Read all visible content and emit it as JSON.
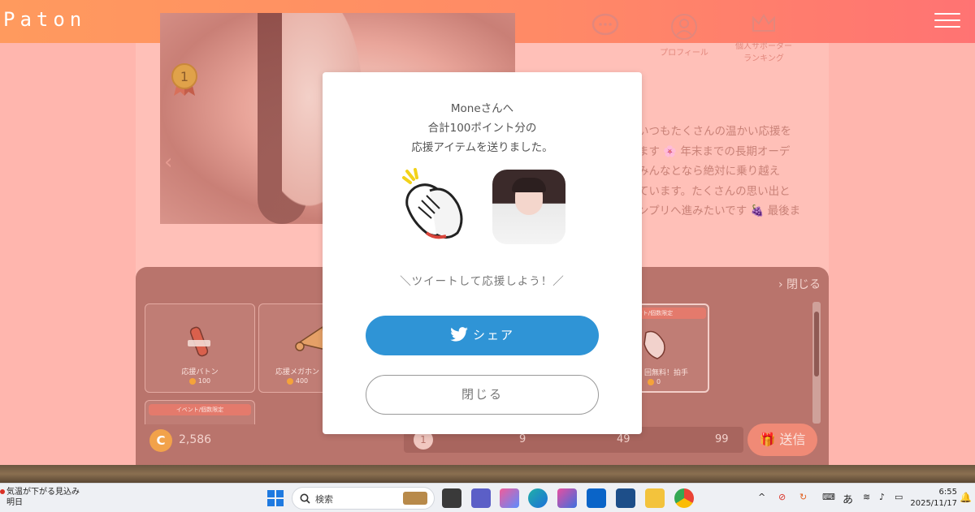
{
  "header": {
    "logo": "Paton"
  },
  "profile": {
    "tabs": [
      {
        "label": ""
      },
      {
        "label": "プロフィール"
      },
      {
        "label": "個人サポーター\nランキング"
      }
    ],
    "text_lines": [
      "いつもたくさんの温かい応援を",
      "ます 🌸 年末までの長期オーデ",
      "みんなとなら絶対に乗り越え",
      "ています。たくさんの思い出と",
      "ンプリへ進みたいです 🍇 最後ま"
    ]
  },
  "gift_panel": {
    "close_label": "閉じる",
    "items": [
      {
        "name": "応援バトン",
        "price": "100"
      },
      {
        "name": "応援メガホン",
        "price": "400"
      },
      {
        "name": "回無料！拍手",
        "price": "0",
        "tag": "ント/個数限定"
      },
      {
        "name": "",
        "price": "",
        "tag": "イベント/個数限定"
      }
    ],
    "coins": "2,586",
    "coin_symbol": "C",
    "quantities": [
      "1",
      "9",
      "49",
      "99"
    ],
    "send_label": "送信"
  },
  "modal": {
    "message_lines": [
      "Moneさんへ",
      "合計100ポイント分の",
      "応援アイテムを送りました。"
    ],
    "tweet_prompt": "＼ツイートして応援しよう！／",
    "share_label": "シェア",
    "close_label": "閉じる"
  },
  "taskbar": {
    "weather_title": "気温が下がる見込み",
    "weather_sub": "明日",
    "search_label": "検索",
    "ime": "あ",
    "time": "6:55",
    "date": "2025/11/17"
  },
  "colors": {
    "header_start": "#ff9a5e",
    "header_end": "#ff7373",
    "share": "#2f94d6",
    "coin": "#f2a24a"
  }
}
